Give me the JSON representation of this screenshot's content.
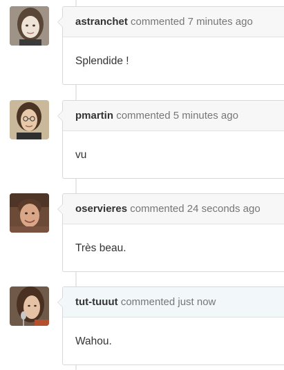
{
  "comments": [
    {
      "author": "astranchet",
      "action": "commented",
      "time": "7 minutes ago",
      "body": "Splendide !"
    },
    {
      "author": "pmartin",
      "action": "commented",
      "time": "5 minutes ago",
      "body": "vu"
    },
    {
      "author": "oservieres",
      "action": "commented",
      "time": "24 seconds ago",
      "body": "Très beau."
    },
    {
      "author": "tut-tuuut",
      "action": "commented",
      "time": "just now",
      "body": "Wahou."
    }
  ],
  "colors": {
    "header_bg": "#f7f7f7",
    "header_bg_latest": "#f2f8fa",
    "border": "#d8d8d8",
    "author_text": "#333333",
    "meta_text": "#767676"
  }
}
